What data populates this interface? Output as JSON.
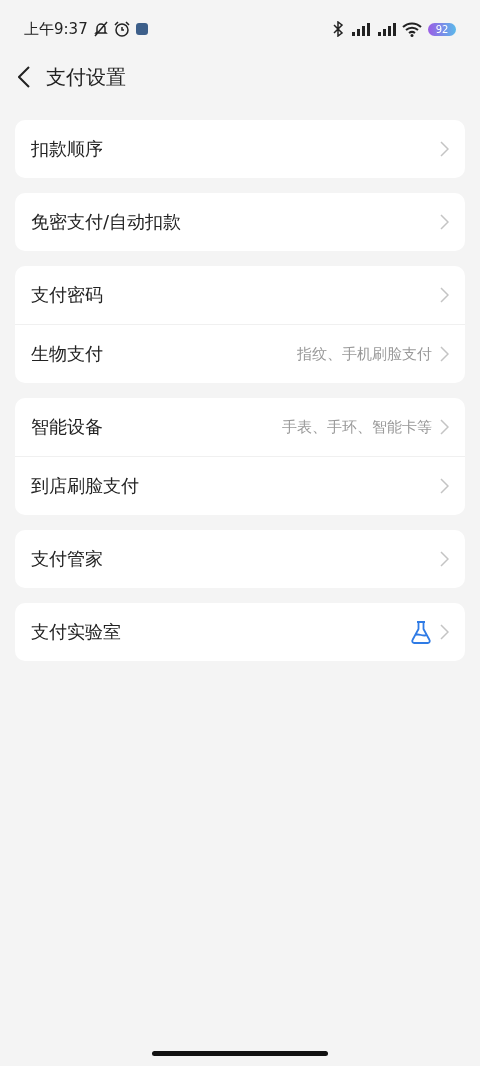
{
  "status_bar": {
    "time": "上午9:37",
    "battery": "92"
  },
  "header": {
    "title": "支付设置"
  },
  "groups": [
    {
      "items": [
        {
          "label": "扣款顺序",
          "kind": "plain"
        }
      ]
    },
    {
      "items": [
        {
          "label": "免密支付/自动扣款",
          "kind": "plain"
        }
      ]
    },
    {
      "items": [
        {
          "label": "支付密码",
          "kind": "plain"
        },
        {
          "label": "生物支付",
          "kind": "plain",
          "value": "指纹、手机刷脸支付"
        }
      ]
    },
    {
      "items": [
        {
          "label": "智能设备",
          "kind": "plain",
          "value": "手表、手环、智能卡等"
        },
        {
          "label": "到店刷脸支付",
          "kind": "plain"
        }
      ]
    },
    {
      "items": [
        {
          "label": "支付管家",
          "kind": "plain"
        }
      ]
    },
    {
      "items": [
        {
          "label": "支付实验室",
          "kind": "icon"
        }
      ]
    }
  ]
}
